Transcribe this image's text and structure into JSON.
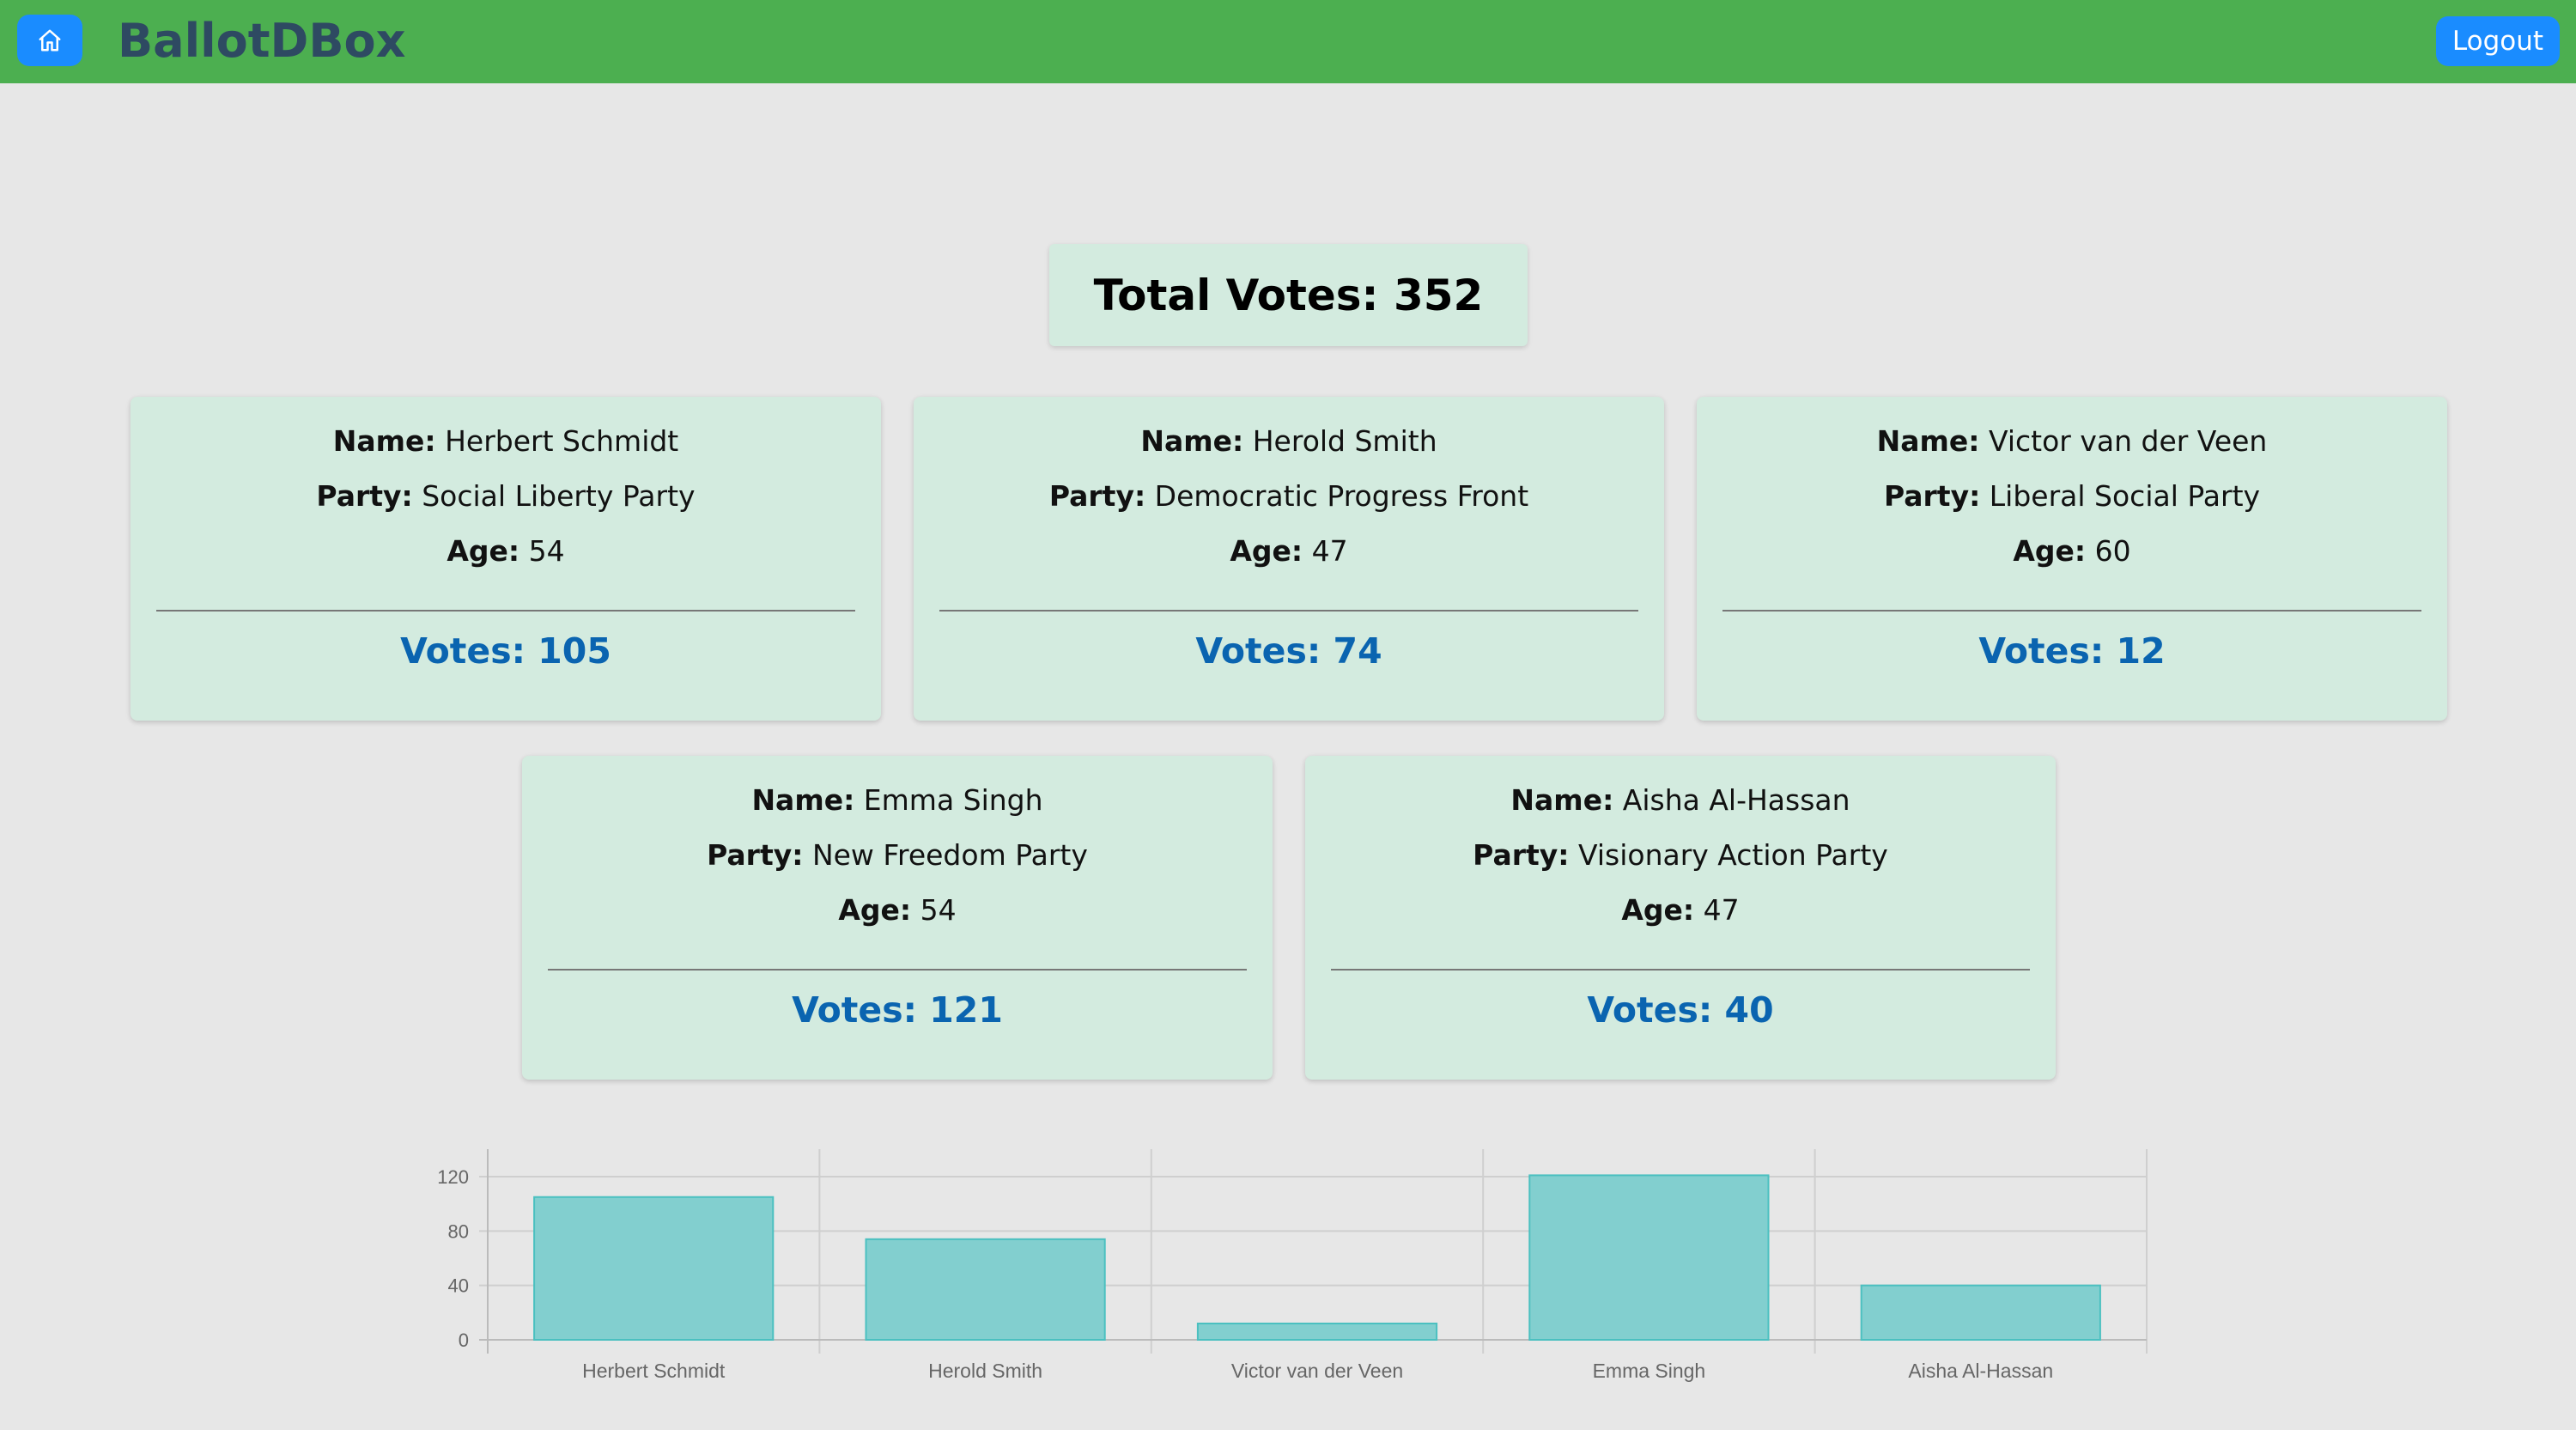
{
  "navbar": {
    "brand": "BallotDBox",
    "logout_label": "Logout",
    "home_icon": "home-icon"
  },
  "summary": {
    "total_label": "Total Votes:",
    "total_value": "352"
  },
  "labels": {
    "name": "Name:",
    "party": "Party:",
    "age": "Age:",
    "votes": "Votes:"
  },
  "candidates": [
    {
      "name": "Herbert Schmidt",
      "party": "Social Liberty Party",
      "age": "54",
      "votes": "105"
    },
    {
      "name": "Herold Smith",
      "party": "Democratic Progress Front",
      "age": "47",
      "votes": "74"
    },
    {
      "name": "Victor van der Veen",
      "party": "Liberal Social Party",
      "age": "60",
      "votes": "12"
    },
    {
      "name": "Emma Singh",
      "party": "New Freedom Party",
      "age": "54",
      "votes": "121"
    },
    {
      "name": "Aisha Al-Hassan",
      "party": "Visionary Action Party",
      "age": "47",
      "votes": "40"
    }
  ],
  "colors": {
    "navbar": "#4caf50",
    "button": "#1a8cff",
    "card": "#d3ebdf",
    "votes_text": "#0a64b0",
    "bar_fill": "#82cfcf",
    "bar_stroke": "#4bc0c0"
  },
  "chart_data": {
    "type": "bar",
    "categories": [
      "Herbert Schmidt",
      "Herold Smith",
      "Victor van der Veen",
      "Emma Singh",
      "Aisha Al-Hassan"
    ],
    "values": [
      105,
      74,
      12,
      121,
      40
    ],
    "yticks": [
      0,
      40,
      80,
      120
    ],
    "ylim": [
      0,
      120
    ],
    "grid": true,
    "legend": "none"
  }
}
